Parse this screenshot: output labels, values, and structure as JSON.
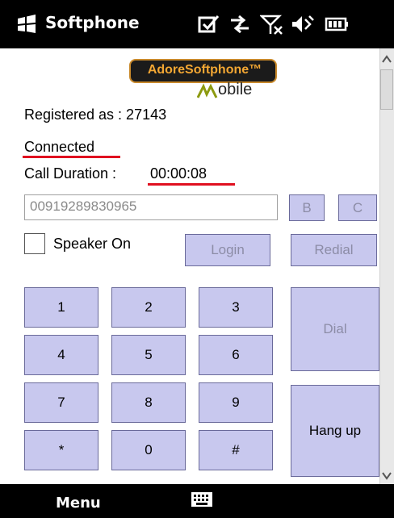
{
  "statusbar": {
    "app_title": "Softphone",
    "icons": [
      "windows-logo-icon",
      "checkbox-notification-icon",
      "data-transfer-icon",
      "no-signal-icon",
      "volume-icon",
      "battery-icon"
    ]
  },
  "logo": {
    "brand_text": "AdoreSoftphone™",
    "mobile_text": "obile"
  },
  "status": {
    "registered_text": "Registered as : 27143",
    "connected_text": "Connected",
    "duration_label": "Call Duration :",
    "duration_value": "00:00:08"
  },
  "number_input": {
    "value": "00919289830965"
  },
  "buttons": {
    "b": "B",
    "c": "C",
    "speaker_label": "Speaker On",
    "login": "Login",
    "redial": "Redial",
    "dial": "Dial",
    "hangup": "Hang up"
  },
  "keypad": [
    "1",
    "2",
    "3",
    "4",
    "5",
    "6",
    "7",
    "8",
    "9",
    "*",
    "0",
    "#"
  ],
  "bottombar": {
    "menu_label": "Menu"
  },
  "colors": {
    "button_bg": "#c8c8ee",
    "underline": "#e01020",
    "logo_orange": "#f3a733"
  }
}
